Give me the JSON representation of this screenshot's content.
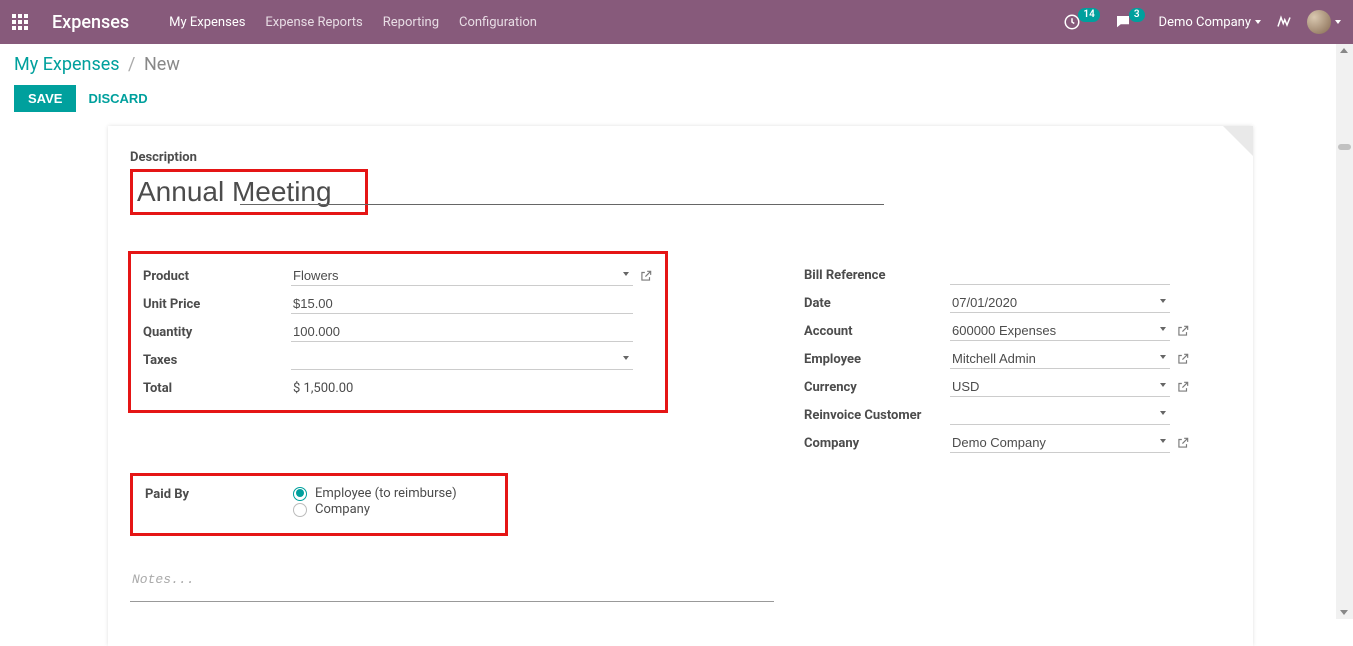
{
  "nav": {
    "brand": "Expenses",
    "items": [
      "My Expenses",
      "Expense Reports",
      "Reporting",
      "Configuration"
    ],
    "clock_badge": "14",
    "chat_badge": "3",
    "company": "Demo Company"
  },
  "breadcrumb": {
    "root": "My Expenses",
    "current": "New"
  },
  "actions": {
    "save": "SAVE",
    "discard": "DISCARD"
  },
  "form": {
    "description_label": "Description",
    "description_value": "Annual Meeting",
    "left": {
      "product_label": "Product",
      "product_value": "Flowers",
      "unit_price_label": "Unit Price",
      "unit_price_value": "$15.00",
      "quantity_label": "Quantity",
      "quantity_value": "100.000",
      "taxes_label": "Taxes",
      "taxes_value": "",
      "total_label": "Total",
      "total_value": "$ 1,500.00"
    },
    "right": {
      "bill_ref_label": "Bill Reference",
      "bill_ref_value": "",
      "date_label": "Date",
      "date_value": "07/01/2020",
      "account_label": "Account",
      "account_value": "600000 Expenses",
      "employee_label": "Employee",
      "employee_value": "Mitchell Admin",
      "currency_label": "Currency",
      "currency_value": "USD",
      "reinvoice_label": "Reinvoice Customer",
      "reinvoice_value": "",
      "company_label": "Company",
      "company_value": "Demo Company"
    },
    "paid_by": {
      "label": "Paid By",
      "opt_employee": "Employee (to reimburse)",
      "opt_company": "Company",
      "selected": "employee"
    },
    "notes_placeholder": "Notes..."
  }
}
